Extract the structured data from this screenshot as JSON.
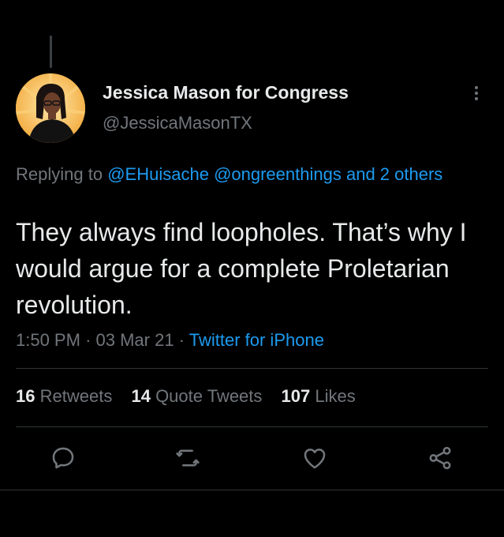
{
  "author": {
    "name": "Jessica Mason for Congress",
    "handle": "@JessicaMasonTX",
    "avatar_icon": "profile-photo"
  },
  "reply": {
    "prefix": "Replying to",
    "mentions": [
      "@EHuisache",
      "@ongreenthings",
      "and 2 others"
    ]
  },
  "tweet": {
    "text": "They always find loopholes. That’s why I would argue for a complete Proletarian revolution."
  },
  "meta": {
    "time": "1:50 PM",
    "date": "03 Mar 21",
    "separator": "·",
    "source": "Twitter for iPhone"
  },
  "stats": {
    "retweets": {
      "count": "16",
      "label": "Retweets"
    },
    "quotes": {
      "count": "14",
      "label": "Quote Tweets"
    },
    "likes": {
      "count": "107",
      "label": "Likes"
    }
  },
  "actions": [
    "reply-icon",
    "retweet-icon",
    "like-icon",
    "share-icon"
  ],
  "colors": {
    "background": "#000000",
    "primary_text": "#e7e9ea",
    "secondary_text": "#71767b",
    "link": "#1d9bf0",
    "divider": "#2f3336"
  }
}
